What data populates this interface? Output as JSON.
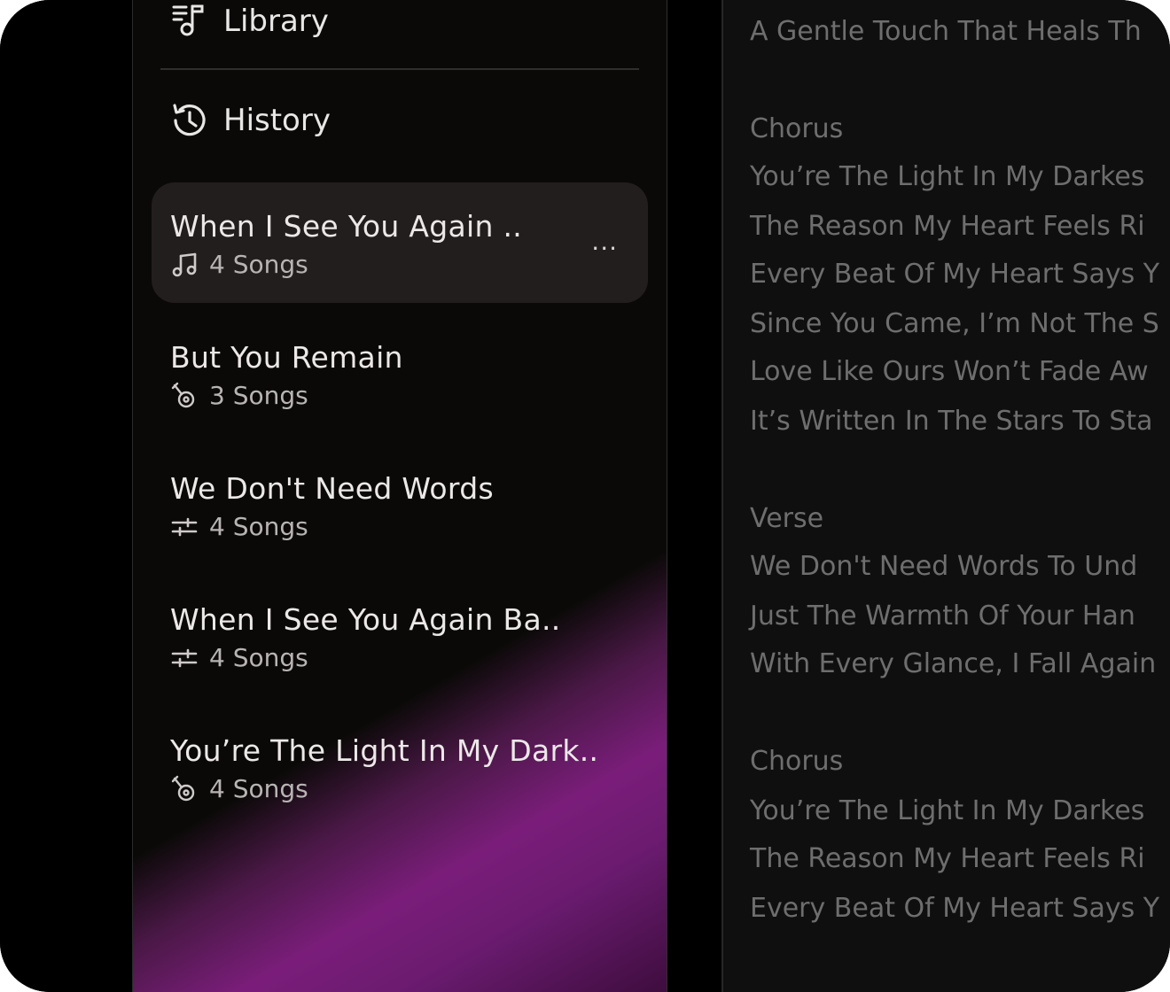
{
  "nav": {
    "library_label": "Library",
    "history_label": "History"
  },
  "playlists": [
    {
      "title": "When I See You Again ..",
      "count": "4 Songs",
      "icon": "music-note-icon",
      "selected": true,
      "more": "..."
    },
    {
      "title": "But You Remain",
      "count": "3 Songs",
      "icon": "guitar-icon",
      "selected": false
    },
    {
      "title": "We Don't Need Words",
      "count": "4 Songs",
      "icon": "sliders-icon",
      "selected": false
    },
    {
      "title": "When I See You Again Ba..",
      "count": "4 Songs",
      "icon": "sliders-icon",
      "selected": false
    },
    {
      "title": "You’re The Light In My Dark..",
      "count": "4 Songs",
      "icon": "guitar-icon",
      "selected": false
    }
  ],
  "lyrics": [
    "A Gentle Touch That Heals Th",
    "Chorus",
    "You’re The Light In My Darkes",
    "The Reason My Heart Feels Ri",
    "Every Beat Of My Heart Says Y",
    "Since You Came, I’m Not The S",
    "Love Like Ours Won’t Fade Aw",
    "It’s Written In The Stars To Sta",
    "Verse",
    "We Don't Need Words To Und",
    "Just The Warmth Of Your Han",
    "With Every Glance, I Fall Again",
    "Chorus",
    "You’re The Light In My Darkes",
    "The Reason My Heart Feels Ri",
    "Every Beat Of My Heart Says Y"
  ],
  "colors": {
    "background": "#000000",
    "sidebar": "#0b0908",
    "selected": "#231e1e",
    "accent": "#7a1d7a",
    "lyrics_text": "#6e6e6e"
  }
}
